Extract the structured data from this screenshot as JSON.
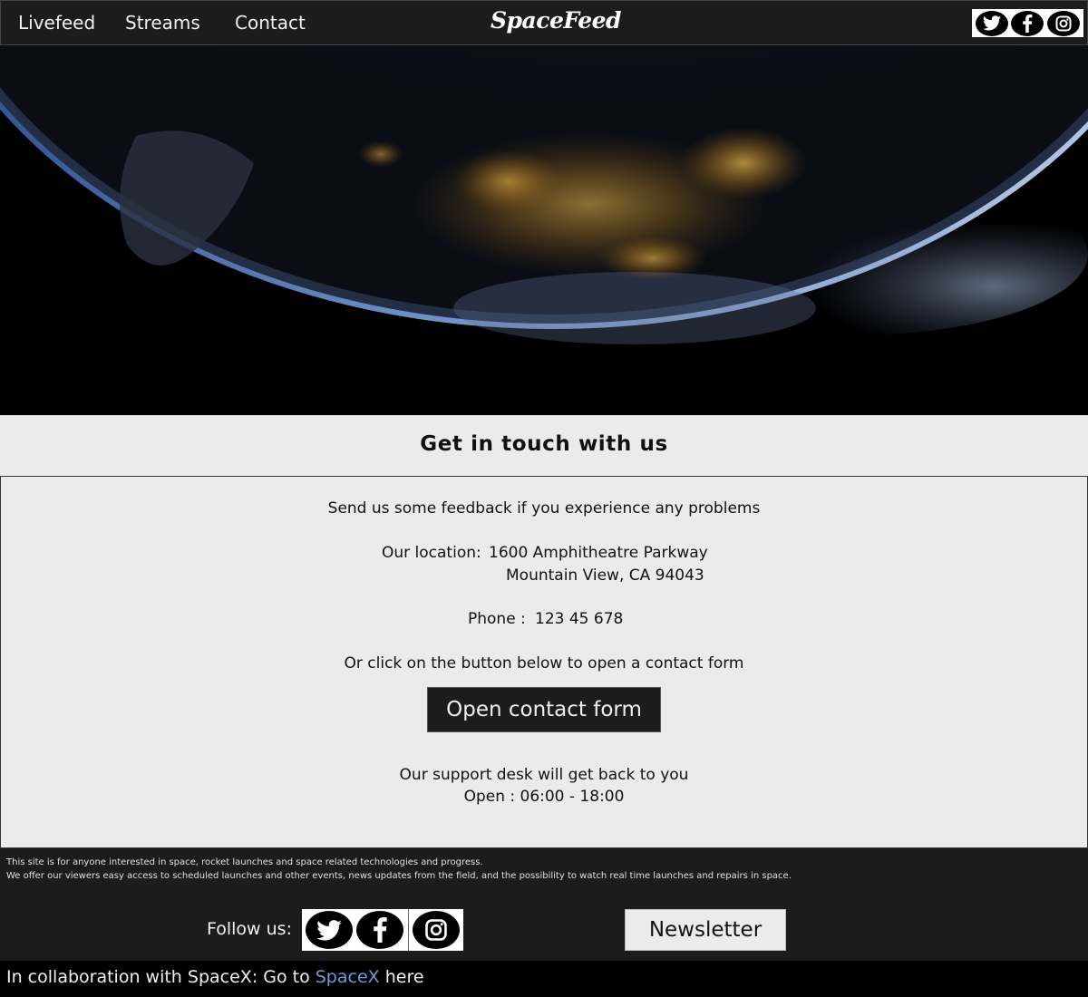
{
  "header": {
    "nav": [
      "Livefeed",
      "Streams",
      "Contact"
    ],
    "logo": "SpaceFeed",
    "social_icons": [
      "twitter-icon",
      "facebook-icon",
      "instagram-icon"
    ]
  },
  "hero": {
    "image": "earth-at-night-from-space"
  },
  "contact": {
    "title": "Get in touch with us",
    "feedback": "Send us some feedback if you experience any problems",
    "location_label": "Our location:",
    "location_line1": "1600 Amphitheatre Parkway",
    "location_line2": "Mountain View, CA 94043",
    "phone_label": "Phone :",
    "phone_value": "123 45 678",
    "form_prompt": "Or click on the button below to open a contact form",
    "form_button": "Open contact form",
    "support_line": "Our support desk will get back to you",
    "hours_line": "Open : 06:00 - 18:00"
  },
  "footer": {
    "about_line1": "This site is for anyone interested in space, rocket launches and space related  technologies and progress.",
    "about_line2": "We offer our viewers easy access to scheduled launches and other events, news updates from the field, and the possibility to watch real time launches and repairs in space.",
    "follow_label": "Follow us:",
    "newsletter_button": "Newsletter",
    "collab_prefix": "In collaboration with SpaceX: Go to ",
    "collab_link": "SpaceX",
    "collab_suffix": " here"
  },
  "colors": {
    "header_bg": "#1c1c1c",
    "content_bg": "#ebebeb",
    "link_blue": "#6f9ad8"
  }
}
